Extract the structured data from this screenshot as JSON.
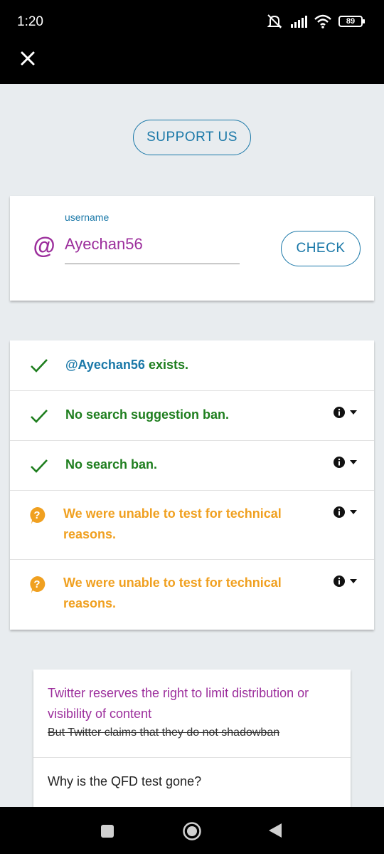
{
  "status_bar": {
    "time": "1:20",
    "battery": "89",
    "icons": [
      "mute-icon",
      "signal-icon",
      "wifi-icon",
      "battery-icon"
    ]
  },
  "app_bar": {
    "close_icon": "close-icon"
  },
  "support_button": {
    "label": "SUPPORT US"
  },
  "username_card": {
    "at_symbol": "@",
    "label": "username",
    "value": "Ayechan56",
    "check_label": "CHECK"
  },
  "results": [
    {
      "status": "ok",
      "icon": "checkmark-icon",
      "handle": "@Ayechan56",
      "text": " exists."
    },
    {
      "status": "ok",
      "icon": "checkmark-icon",
      "text": "No search suggestion ban."
    },
    {
      "status": "ok",
      "icon": "checkmark-icon",
      "text": "No search ban."
    },
    {
      "status": "unknown",
      "icon": "question-icon",
      "text": "We were unable to test for technical reasons."
    },
    {
      "status": "unknown",
      "icon": "question-icon",
      "text": "We were unable to test for technical reasons."
    }
  ],
  "faq": {
    "items": [
      {
        "title": "Twitter reserves the right to limit distribution or visibility of content",
        "subtitle": "But Twitter claims that they do not shadowban"
      },
      {
        "title": "Why is the QFD test gone?"
      }
    ]
  },
  "colors": {
    "accent_blue": "#1a78a8",
    "purple": "#9c2e9c",
    "success_green": "#1e7e1e",
    "warning_orange": "#f0a020",
    "background": "#e8ecef"
  }
}
